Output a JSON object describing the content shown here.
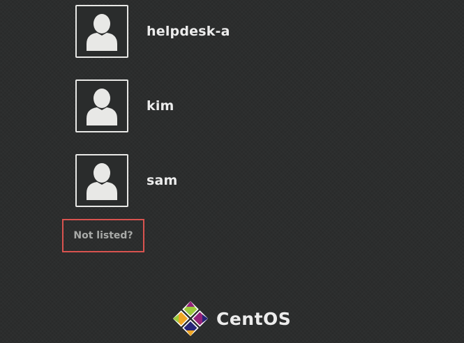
{
  "users": [
    {
      "name": "helpdesk-a",
      "avatar_icon": "user-silhouette-icon"
    },
    {
      "name": "kim",
      "avatar_icon": "user-silhouette-icon"
    },
    {
      "name": "sam",
      "avatar_icon": "user-silhouette-icon"
    }
  ],
  "not_listed": {
    "label": "Not listed?",
    "highlight_color": "#d9534f"
  },
  "branding": {
    "logo_text": "CentOS",
    "logo_icon": "centos-logo-icon"
  },
  "colors": {
    "background": "#2a2c2c",
    "text": "#ececec",
    "link_text": "#a8aaa8",
    "avatar": "#e8e8e6"
  }
}
